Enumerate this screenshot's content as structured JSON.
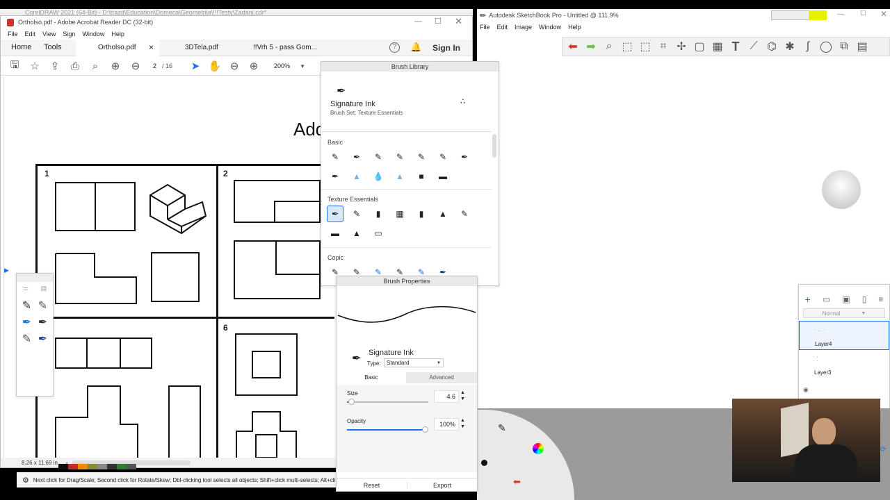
{
  "corel_title": "CorelDRAW 2021 (64-Bit) - D:\\trazd\\Education\\Domeca\\Geometrija\\!!!Testy\\Zadani.cdr*",
  "acrobat": {
    "title": "Ortholso.pdf - Adobe Acrobat Reader DC (32-bit)",
    "menu": [
      "File",
      "Edit",
      "View",
      "Sign",
      "Window",
      "Help"
    ],
    "nav": {
      "home": "Home",
      "tools": "Tools",
      "sign_in": "Sign In"
    },
    "tabs": [
      {
        "label": "Ortholso.pdf",
        "close": "×"
      },
      {
        "label": "3DTela.pdf"
      },
      {
        "label": "!!Vrh 5  -  pass Gom..."
      }
    ],
    "page_current": "2",
    "page_total": "/ 16",
    "zoom": "200%",
    "doc_heading": "Add",
    "cell_numbers": [
      "1",
      "2",
      "6"
    ],
    "page_size": "8.26 x 11.69 in"
  },
  "corel_status": "Next click for Drag/Scale; Second click for Rotate/Skew; Dbl-clicking tool selects all objects; Shift+click multi-selects; Alt+cli",
  "sketchbook": {
    "title": "Autodesk SketchBook Pro - Untitled @ 111.9%",
    "menu": [
      "File",
      "Edit",
      "Image",
      "Window",
      "Help"
    ]
  },
  "brush_library": {
    "title": "Brush Library",
    "brush_name": "Signature Ink",
    "brush_set": "Brush Set: Texture Essentials",
    "sections": [
      "Basic",
      "Texture Essentials",
      "Copic"
    ]
  },
  "brush_properties": {
    "title": "Brush Properties",
    "brush_name": "Signature Ink",
    "type_label": "Type:",
    "type_value": "Standard",
    "tab_basic": "Basic",
    "tab_advanced": "Advanced",
    "size_label": "Size",
    "size_value": "4.6",
    "size_fraction": 0.05,
    "opacity_label": "Opacity",
    "opacity_value": "100%",
    "opacity_fraction": 1.0,
    "reset": "Reset",
    "export": "Export"
  },
  "layers": {
    "blend_mode": "Normal",
    "items": [
      "Layer4",
      "Layer3"
    ]
  },
  "colors": {
    "accent_blue": "#1a73e8",
    "yellow_swatch": "#e6f000",
    "red_arrow": "#d9342b",
    "green_arrow": "#6cc04a"
  }
}
